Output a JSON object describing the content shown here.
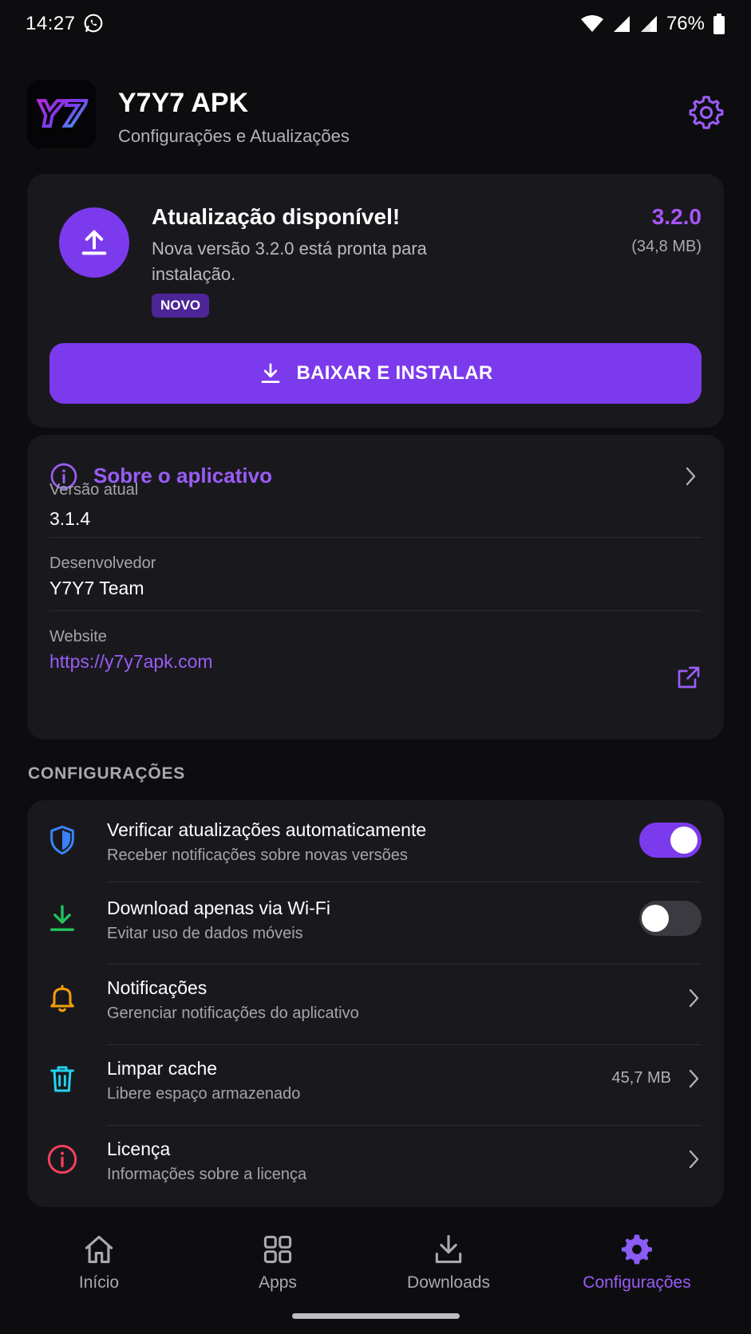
{
  "status_bar": {
    "time": "14:27",
    "battery": "76%",
    "icons": [
      "whatsapp-icon",
      "wifi-icon",
      "signal-icon",
      "signal-icon",
      "battery-icon"
    ]
  },
  "header": {
    "logo_text": "Y7",
    "title": "Y7Y7 APK",
    "subtitle": "Configurações e Atualizações",
    "settings_icon": "gear-icon"
  },
  "update": {
    "title": "Atualização disponível!",
    "description": "Nova versão 3.2.0 está pronta para instalação.",
    "badge": "NOVO",
    "version": "3.2.0",
    "size": "(34,8 MB)",
    "button_label": "BAIXAR E INSTALAR"
  },
  "about": {
    "title": "Sobre o aplicativo",
    "rows": [
      {
        "label": "Versão atual",
        "value": "3.1.4"
      },
      {
        "label": "Desenvolvedor",
        "value": "Y7Y7 Team"
      },
      {
        "label": "Website",
        "value": "https://y7y7apk.com"
      }
    ]
  },
  "settings": {
    "section_title": "CONFIGURAÇÕES",
    "items": [
      {
        "title": "Verificar atualizações automaticamente",
        "subtitle": "Receber notificações sobre novas versões",
        "icon": "shield-icon",
        "toggle": true
      },
      {
        "title": "Download apenas via Wi-Fi",
        "subtitle": "Evitar uso de dados móveis",
        "icon": "download-icon",
        "toggle": false
      },
      {
        "title": "Notificações",
        "subtitle": "Gerenciar notificações do aplicativo",
        "icon": "bell-icon"
      },
      {
        "title": "Limpar cache",
        "subtitle": "Libere espaço armazenado",
        "icon": "trash-icon",
        "value": "45,7 MB"
      },
      {
        "title": "Licença",
        "subtitle": "Informações sobre a licença",
        "icon": "info-icon"
      }
    ]
  },
  "nav": {
    "items": [
      {
        "label": "Início",
        "icon": "home-icon"
      },
      {
        "label": "Apps",
        "icon": "grid-icon"
      },
      {
        "label": "Downloads",
        "icon": "download-icon"
      },
      {
        "label": "Configurações",
        "icon": "gear-icon",
        "active": true
      }
    ]
  },
  "colors": {
    "accent": "#7c3aed",
    "accent_text": "#9b5cf6",
    "background": "#0d0d10",
    "card": "#19191d"
  }
}
